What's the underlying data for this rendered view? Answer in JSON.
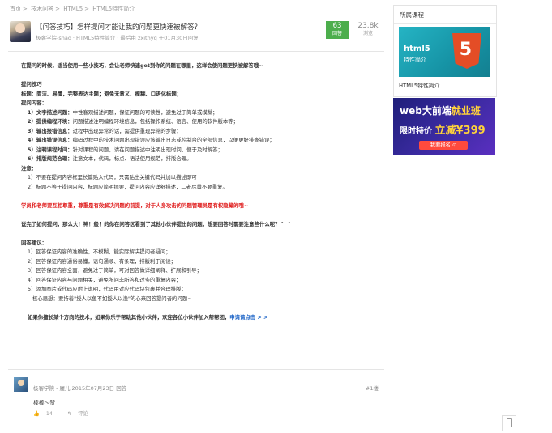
{
  "breadcrumb": [
    "首页",
    "技术问答",
    "HTML5",
    "HTML5特性简介"
  ],
  "breadcrumb_sep": ">",
  "question": {
    "title": "【问答技巧】怎样提问才能让我的问题更快速被解答？",
    "meta": "极客学院-shao · HTML5特性简介 · 最后由 zxithyq 于01月30日回复",
    "answers_count": "63",
    "answers_label": "回答",
    "views_count": "23.8k",
    "views_label": "浏览"
  },
  "content": {
    "intro": "在提问的时候，适当使用一些小技巧，会让老师快速get到你的问题在哪里，这样会使问题更快被解答哦~",
    "tips_heading": "提问技巧",
    "title_rule": "标题：简洁、易懂，完整表达主题；避免无意义、模糊、口语化标题；",
    "content_heading": "提问内容：",
    "items": [
      {
        "label": "1）文字描述问题：",
        "text": "中性客观描述问题，保证问题的可读性，避免过于简单或模糊；"
      },
      {
        "label": "2）提供编程环境：",
        "text": "问题描述注明编程环境信息，包括操作系统、语言、使用的软件版本等；"
      },
      {
        "label": "3）输出报错信息：",
        "text": "过程中出现异常的话，需提供重现异常的步骤；"
      },
      {
        "label": "4）输出错误信息：",
        "text": "编码过程中的技术问题出现错误应该输出日志或控制台的全部信息，以便更好排查错误；"
      },
      {
        "label": "5）注明课程时间：",
        "text": "针对课程的问题，请在问题描述中注明出现时间，便于及时解答；"
      },
      {
        "label": "6）排版规范合理：",
        "text": "注意文本，代码，标点、语法使用规范，排版合理。"
      }
    ],
    "note_heading": "注意：",
    "notes": [
      "1）不要在提问内容框里长篇贴入代码，只需贴出关键代码并加以描述即可",
      "2）标题不等于提问内容，标题应简明扼要，提问内容应详细描述，二者尽量不要重复。"
    ],
    "warning": "学员和老师要互相尊重，尊重是有效解决问题的前提，对于人身攻击的问题管理员是有权隐藏的哦~",
    "transition": "说完了如何提问，那么大！神！般！的你在问答区看到了其他小伙伴提出的问题，想要回答时需要注意些什么呢？^_^",
    "answer_heading": "回答建议：",
    "answer_items": [
      "1）回答保证内容的准确性，不模糊，能实际解决提问者疑问；",
      "2）回答保证内容通俗易懂，语句通顺、有条理，排版利于阅读；",
      "3）回答保证内容全面，避免过于简单，可对回答做详细阐释、扩展和引导；",
      "4）回答保证内容与问题相关，避免所问非所答和过多的重复内容；",
      "5）添加图片或代码应附上说明，代码用对应代码块包裹并合理排版；"
    ],
    "core_idea": "核心思想：要持着\"授人以鱼不如授人以渔\"的心来回答提问者的问题~",
    "closing": "如果你擅长某个方向的技术，如果你乐于帮助其他小伙伴，欢迎各位小伙伴加入帮帮团，",
    "closing_link": "申请请点击 > >"
  },
  "reply": {
    "meta": "极客学院 - 履儿 2015年07月23日 回答",
    "floor": "#1楼",
    "text": "棒棒～赞",
    "likes": "14",
    "comment_label": "评论"
  },
  "sidebar": {
    "title": "所属课程",
    "course_image_title": "html5",
    "course_image_subtitle": "特性简介",
    "course_image_logo": "5",
    "course_name": "HTML5特性简介"
  },
  "ad": {
    "line1_prefix": "web大前端",
    "line1_highlight": "就业班",
    "line2_prefix": "限时特价 ",
    "line2_highlight": "立减¥399",
    "button": "我要报名 ⊙"
  },
  "icons": {
    "like": "thumbs-up-icon",
    "comment": "comment-icon",
    "mobile": "mobile-icon"
  }
}
